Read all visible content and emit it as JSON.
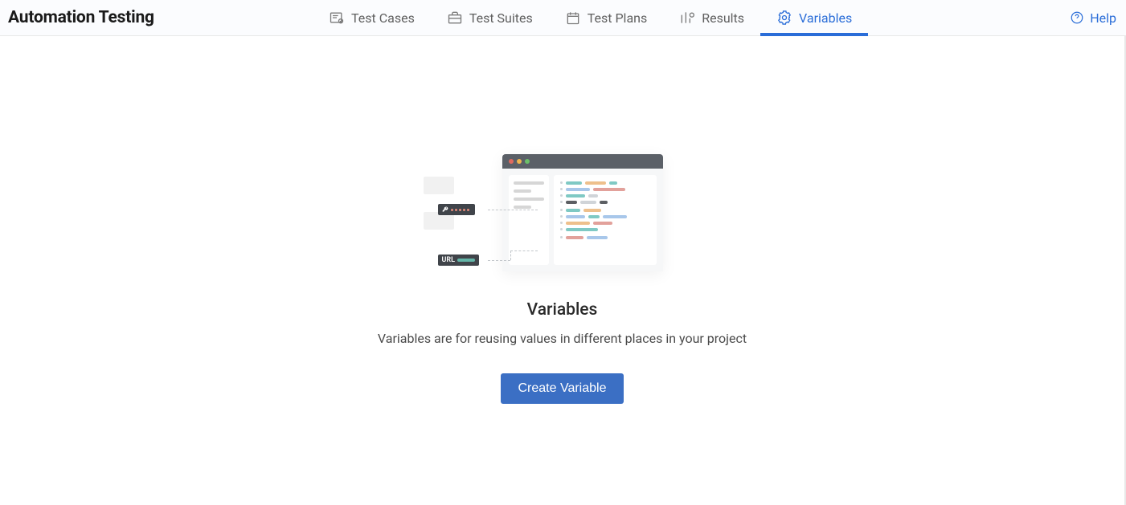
{
  "header": {
    "title": "Automation Testing",
    "nav": [
      {
        "label": "Test Cases"
      },
      {
        "label": "Test Suites"
      },
      {
        "label": "Test Plans"
      },
      {
        "label": "Results"
      },
      {
        "label": "Variables"
      }
    ],
    "help_label": "Help"
  },
  "empty": {
    "title": "Variables",
    "subtitle": "Variables are for reusing values in different places in your project",
    "button": "Create Variable",
    "illus_url_label": "URL"
  }
}
